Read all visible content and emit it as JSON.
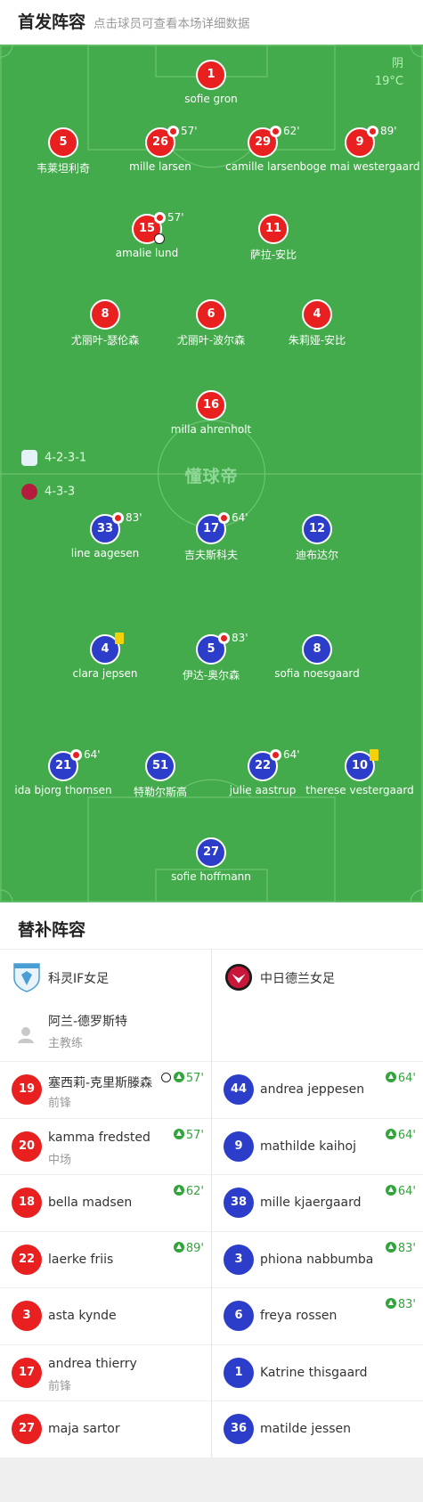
{
  "header": {
    "title": "首发阵容",
    "subtitle": "点击球员可查看本场详细数据"
  },
  "weather": {
    "condition": "阴",
    "temp": "19°C"
  },
  "watermark": "懂球帝",
  "formations": {
    "home": "4-2-3-1",
    "away": "4-3-3"
  },
  "home_players": [
    {
      "num": "1",
      "name": "sofie gron"
    },
    {
      "num": "5",
      "name": "韦莱坦利奇"
    },
    {
      "num": "26",
      "name": "mille larsen",
      "sub": "57'"
    },
    {
      "num": "29",
      "name": "camille larsen",
      "sub": "62'"
    },
    {
      "num": "9",
      "name": "boge mai westergaard",
      "sub": "89'"
    },
    {
      "num": "15",
      "name": "amalie lund",
      "sub": "57'",
      "goal": true
    },
    {
      "num": "11",
      "name": "萨拉-安比"
    },
    {
      "num": "8",
      "name": "尤丽叶-瑟伦森"
    },
    {
      "num": "6",
      "name": "尤丽叶-波尔森"
    },
    {
      "num": "4",
      "name": "朱莉娅-安比"
    },
    {
      "num": "16",
      "name": "milla ahrenholt"
    }
  ],
  "away_players": [
    {
      "num": "33",
      "name": "line aagesen",
      "sub": "83'"
    },
    {
      "num": "17",
      "name": "吉夫斯科夫",
      "sub": "64'"
    },
    {
      "num": "12",
      "name": "迪布达尔"
    },
    {
      "num": "4",
      "name": "clara jepsen",
      "yellow": true
    },
    {
      "num": "5",
      "name": "伊达-奥尔森",
      "sub": "83'"
    },
    {
      "num": "8",
      "name": "sofia noesgaard"
    },
    {
      "num": "21",
      "name": "ida bjorg thomsen",
      "sub": "64'"
    },
    {
      "num": "51",
      "name": "特勒尔斯高"
    },
    {
      "num": "22",
      "name": "julie aastrup",
      "sub": "64'"
    },
    {
      "num": "10",
      "name": "therese vestergaard",
      "yellow": true
    },
    {
      "num": "27",
      "name": "sofie hoffmann"
    }
  ],
  "subs_header": "替补阵容",
  "home_team": {
    "name": "科灵IF女足",
    "coach": "阿兰-德罗斯特",
    "coach_role": "主教练"
  },
  "away_team": {
    "name": "中日德兰女足"
  },
  "home_subs": [
    {
      "num": "19",
      "name": "塞西莉-克里斯滕森",
      "pos": "前锋",
      "time": "57'",
      "goal": true
    },
    {
      "num": "20",
      "name": "kamma fredsted",
      "pos": "中场",
      "time": "57'"
    },
    {
      "num": "18",
      "name": "bella madsen",
      "pos": "",
      "time": "62'"
    },
    {
      "num": "22",
      "name": "laerke friis",
      "pos": "",
      "time": "89'"
    },
    {
      "num": "3",
      "name": "asta kynde",
      "pos": "",
      "time": ""
    },
    {
      "num": "17",
      "name": "andrea thierry",
      "pos": "前锋",
      "time": ""
    },
    {
      "num": "27",
      "name": "maja sartor",
      "pos": "",
      "time": ""
    }
  ],
  "away_subs": [
    {
      "num": "44",
      "name": "andrea jeppesen",
      "time": "64'"
    },
    {
      "num": "9",
      "name": "mathilde kaihoj",
      "time": "64'"
    },
    {
      "num": "38",
      "name": "mille kjaergaard",
      "time": "64'"
    },
    {
      "num": "3",
      "name": "phiona nabbumba",
      "time": "83'"
    },
    {
      "num": "6",
      "name": "freya rossen",
      "time": "83'"
    },
    {
      "num": "1",
      "name": "Katrine thisgaard",
      "time": ""
    },
    {
      "num": "36",
      "name": "matilde jessen",
      "time": ""
    }
  ]
}
